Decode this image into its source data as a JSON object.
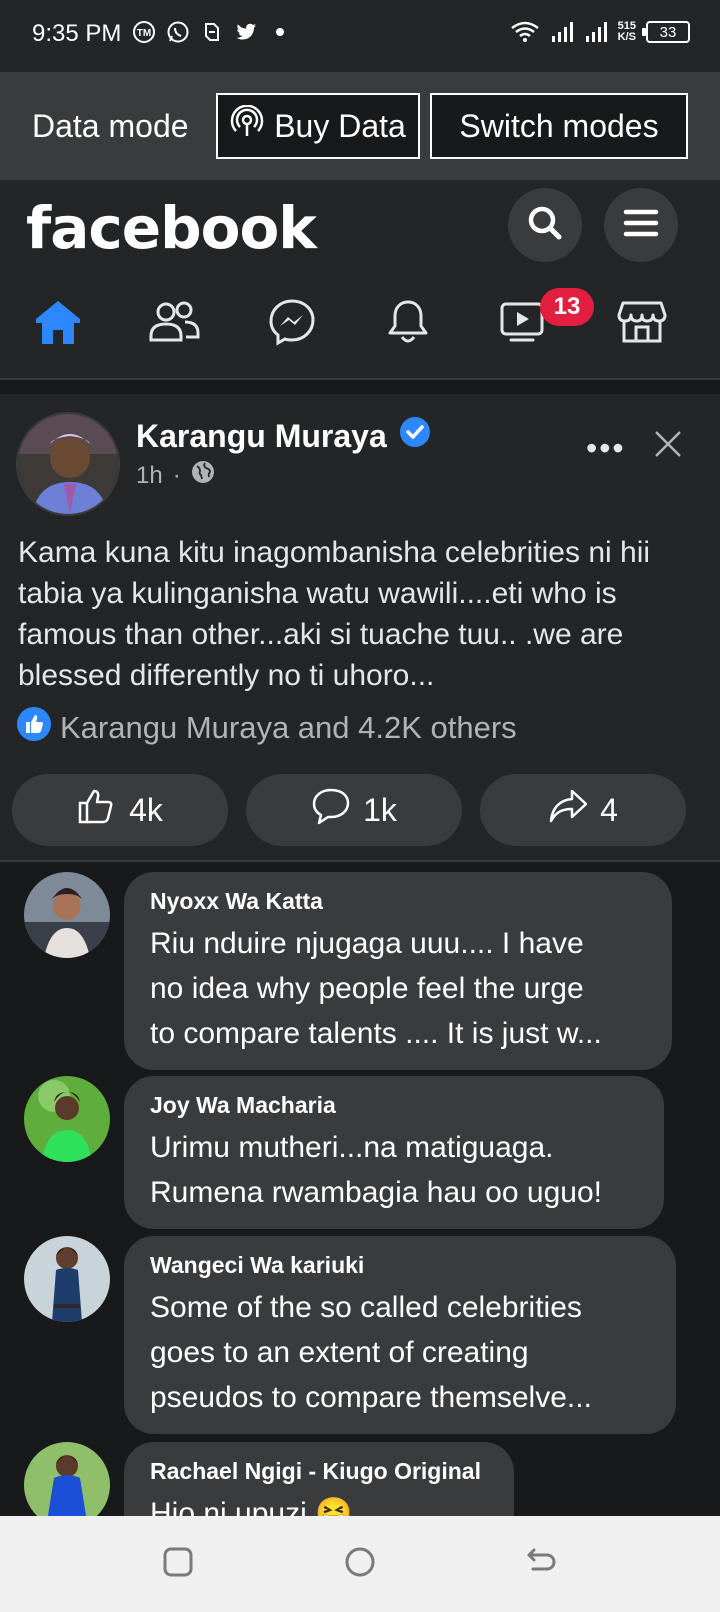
{
  "status_bar": {
    "time": "9:35 PM",
    "left_icons": [
      "tm-app-icon",
      "whatsapp-icon",
      "app-icon",
      "twitter-icon",
      "dot-icon"
    ],
    "network_speed_value": "515",
    "network_speed_unit": "K/S",
    "battery": "33"
  },
  "data_mode_bar": {
    "label": "Data mode",
    "buy_data_label": "Buy Data",
    "switch_modes_label": "Switch modes"
  },
  "header": {
    "logo_text": "facebook",
    "nav_items": [
      "home-icon",
      "friends-icon",
      "messenger-icon",
      "notifications-icon",
      "watch-icon",
      "marketplace-icon"
    ],
    "watch_badge": "13",
    "accent_color": "#2d88ff",
    "badge_color": "#e41e3f"
  },
  "post": {
    "author": "Karangu Muraya",
    "verified": true,
    "time": "1h",
    "privacy_icon": "globe-icon",
    "text": "Kama kuna kitu inagombanisha celebrities ni hii tabia ya kulinganisha watu wawili....eti who is famous than other...aki si tuache tuu.. .we are blessed differently no ti uhoro...",
    "reactions_summary": "Karangu Muraya and 4.2K others",
    "like_count": "4k",
    "comment_count": "1k",
    "share_count": "4"
  },
  "comments": [
    {
      "name": "Nyoxx Wa Katta",
      "lines": [
        "Riu nduire njugaga uuu.... I have",
        "no idea why people feel the urge",
        "to compare talents .... It is just w..."
      ]
    },
    {
      "name": "Joy Wa Macharia",
      "lines": [
        "Urimu mutheri...na matiguaga.",
        "Rumena rwambagia hau oo uguo!"
      ]
    },
    {
      "name": "Wangeci Wa kariuki",
      "lines": [
        "Some of the so called celebrities",
        "goes to an extent of creating",
        "pseudos to compare themselve..."
      ]
    },
    {
      "name": "Rachael Ngigi - Kiugo Original",
      "lines": [
        "Hio ni upuzi 😆"
      ]
    }
  ],
  "system_nav": [
    "recent-apps-icon",
    "home-circle-icon",
    "back-icon"
  ]
}
